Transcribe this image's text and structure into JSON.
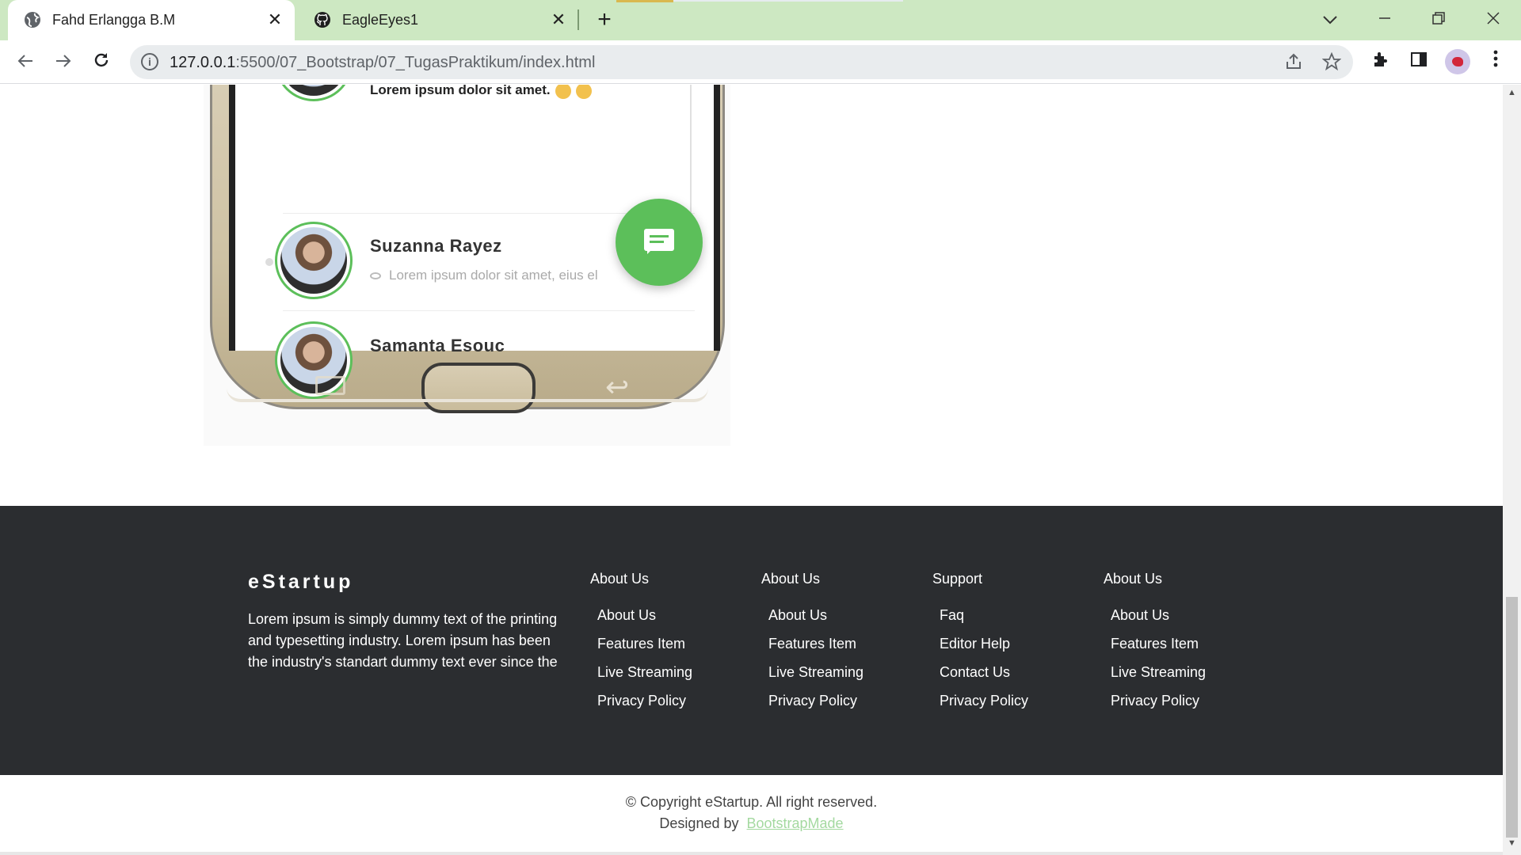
{
  "browser": {
    "tabs": [
      {
        "title": "Fahd Erlangga B.M",
        "active": true,
        "icon": "globe-icon"
      },
      {
        "title": "EagleEyes1",
        "active": false,
        "icon": "github-icon"
      }
    ],
    "url_host": "127.0.0.1",
    "url_path": ":5500/07_Bootstrap/07_TugasPraktikum/index.html"
  },
  "phone": {
    "chats": [
      {
        "name": "",
        "message": "Lorem ipsum dolor sit amet."
      },
      {
        "name": "Suzanna Rayez",
        "message": "Lorem ipsum dolor sit amet, eius el"
      },
      {
        "name": "Samanta Esouc",
        "message": ""
      }
    ],
    "accent_color": "#5cbf5a"
  },
  "footer": {
    "brand": "eStartup",
    "about_text": "Lorem ipsum is simply dummy text of the printing and typesetting industry. Lorem ipsum has been the industry's standart dummy text ever since the",
    "columns": [
      {
        "heading": "About Us",
        "links": [
          "About Us",
          "Features Item",
          "Live Streaming",
          "Privacy Policy"
        ]
      },
      {
        "heading": "About Us",
        "links": [
          "About Us",
          "Features Item",
          "Live Streaming",
          "Privacy Policy"
        ]
      },
      {
        "heading": "Support",
        "links": [
          "Faq",
          "Editor Help",
          "Contact Us",
          "Privacy Policy"
        ]
      },
      {
        "heading": "About Us",
        "links": [
          "About Us",
          "Features Item",
          "Live Streaming",
          "Privacy Policy"
        ]
      }
    ],
    "copyright": "© Copyright eStartup. All right reserved.",
    "designed_by_label": "Designed by",
    "designed_by_link": "BootstrapMade"
  }
}
